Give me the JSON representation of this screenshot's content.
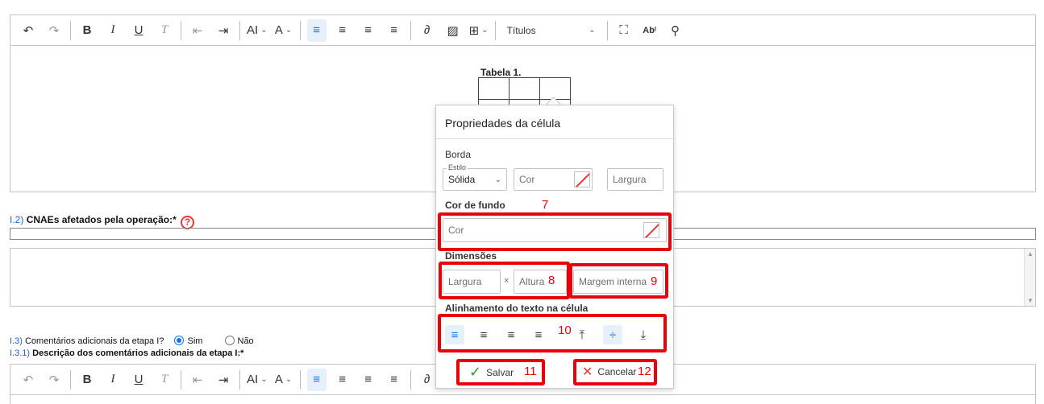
{
  "toolbar": {
    "undo": "↶",
    "redo": "↷",
    "bold": "B",
    "italic": "I",
    "underline": "U",
    "clear_format": "T",
    "outdent": "⇤",
    "indent": "⇥",
    "font_size": "AI",
    "font_style": "A",
    "align_left": "≡",
    "align_center": "≡",
    "align_right": "≡",
    "align_justify": "≡",
    "link": "∂",
    "image": "▨",
    "table": "⊞",
    "heading_select": "Títulos",
    "fullscreen": "⛶",
    "spellcheck": "Abᴵ",
    "accessibility": "⚲"
  },
  "table": {
    "caption": "Tabela 1."
  },
  "form": {
    "q1_2_num": "I.2)",
    "q1_2_label": "CNAEs afetados pela operação:*",
    "help_mark": "?",
    "q1_3_num": "I.3)",
    "q1_3_label": "Comentários adicionais da etapa I?",
    "radio_yes": "Sim",
    "radio_no": "Não",
    "q1_3_1_num": "I.3.1)",
    "q1_3_1_label": "Descrição dos comentários adicionais da etapa I:*"
  },
  "popup": {
    "title": "Propriedades da célula",
    "border_section": "Borda",
    "style_legend": "Estilo",
    "style_value": "Sólida",
    "border_color_placeholder": "Cor",
    "border_width_placeholder": "Largura",
    "bg_section": "Cor de fundo",
    "bg_color_placeholder": "Cor",
    "dimensions_section": "Dimensões",
    "width_placeholder": "Largura",
    "times": "×",
    "height_placeholder": "Altura",
    "padding_placeholder": "Margem interna",
    "text_align_section": "Alinhamento do texto na célula",
    "save_label": "Salvar",
    "cancel_label": "Cancelar"
  },
  "annotations": {
    "n7": "7",
    "n8": "8",
    "n9": "9",
    "n10": "10",
    "n11": "11",
    "n12": "12"
  },
  "colors": {
    "accent": "#1a73e8",
    "annotation_red": "#e8000b",
    "question_num": "#2b61c6"
  }
}
